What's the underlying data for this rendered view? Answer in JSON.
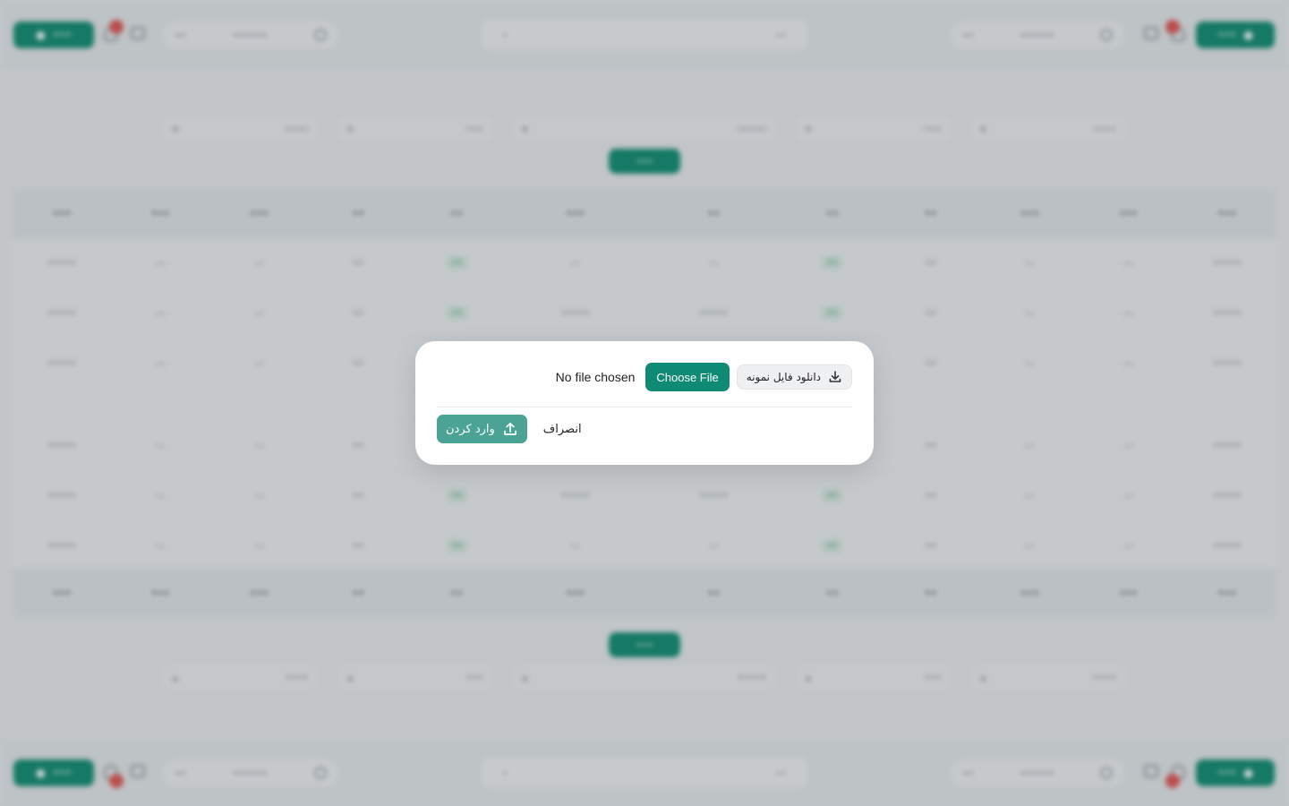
{
  "modal": {
    "download_label": "دانلود فایل نمونه",
    "choose_file_label": "Choose File",
    "file_status": "No file chosen",
    "import_label": "وارد کردن",
    "cancel_label": "انصراف"
  },
  "colors": {
    "accent": "#0f8a74",
    "accent_disabled": "#4aa394"
  }
}
